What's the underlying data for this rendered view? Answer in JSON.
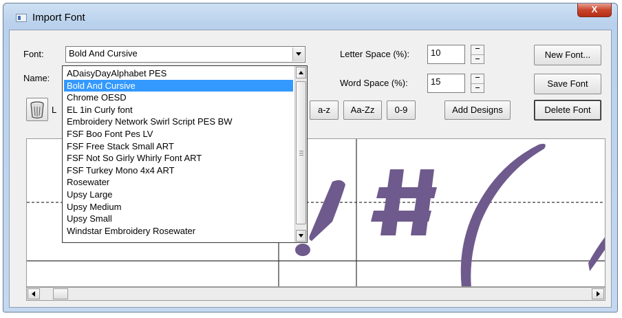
{
  "window": {
    "title": "Import Font",
    "close_glyph": "X"
  },
  "font_row": {
    "label": "Font:",
    "selected": "Bold And Cursive"
  },
  "name_row": {
    "label": "Name:",
    "hidden_prefix": "L"
  },
  "letter_space": {
    "label": "Letter Space (%):",
    "value": "10"
  },
  "word_space": {
    "label": "Word Space (%):",
    "value": "15"
  },
  "buttons": {
    "new_font": "New Font...",
    "save_font": "Save Font",
    "delete_font": "Delete Font",
    "lowercase": "a-z",
    "mixed_case": "Aa-Zz",
    "digits": "0-9",
    "add_designs": "Add Designs"
  },
  "font_list": [
    "ADaisyDayAlphabet PES",
    "Bold And Cursive",
    "Chrome OESD",
    "EL 1in Curly font",
    "Embroidery Network Swirl Script PES BW",
    "FSF Boo Font Pes LV",
    "FSF Free Stack Small ART",
    "FSF Not So Girly Whirly Font ART",
    "FSF Turkey Mono 4x4 ART",
    "Rosewater",
    "Upsy Large",
    "Upsy Medium",
    "Upsy Small",
    "Windstar Embroidery Rosewater"
  ],
  "font_list_selected_index": 1,
  "preview": {
    "glyphs_shown": [
      "!",
      "#",
      "("
    ],
    "stitch_color": "#6e5a8c"
  },
  "icons": {
    "trash": "trash-icon",
    "window": "window-icon"
  }
}
